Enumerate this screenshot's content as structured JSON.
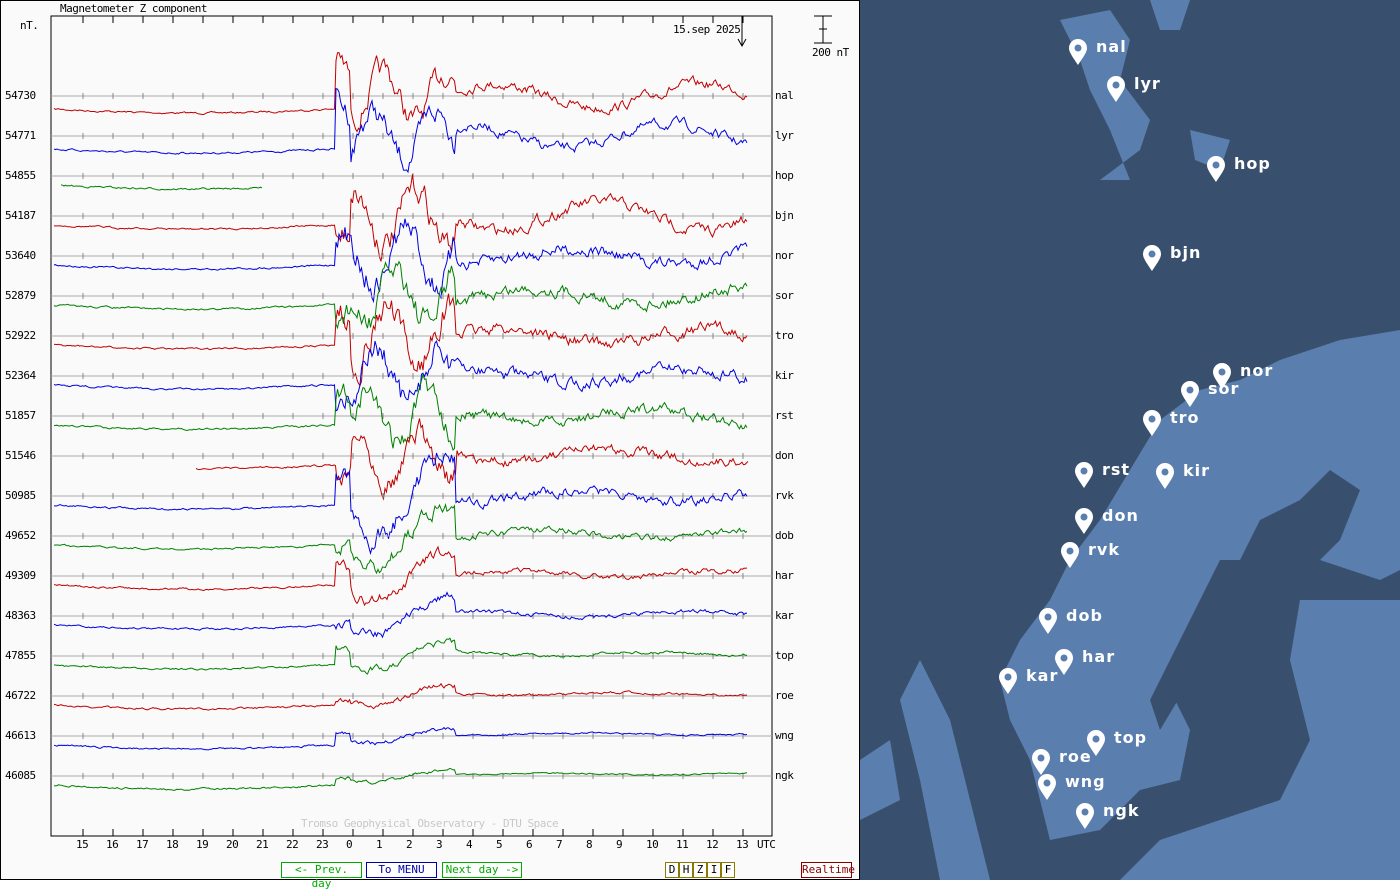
{
  "chart": {
    "title": "Magnetometer Z component",
    "unit": "nT.",
    "date": "15.sep 2025",
    "scale_label": "200 nT",
    "credit": "Tromso Geophysical Observatory - DTU Space",
    "x_ticks": [
      "15",
      "16",
      "17",
      "18",
      "19",
      "20",
      "21",
      "22",
      "23",
      "0",
      "1",
      "2",
      "3",
      "4",
      "5",
      "6",
      "7",
      "8",
      "9",
      "10",
      "11",
      "12",
      "13"
    ],
    "x_unit": "UTC"
  },
  "chart_data": {
    "type": "line",
    "title": "Magnetometer Z component",
    "xlabel": "UTC",
    "ylabel": "nT",
    "series": [
      {
        "name": "nal",
        "baseline": 54730,
        "color": "#c00000"
      },
      {
        "name": "lyr",
        "baseline": 54771,
        "color": "#0000e0"
      },
      {
        "name": "hop",
        "baseline": 54855,
        "color": "#008000"
      },
      {
        "name": "bjn",
        "baseline": 54187,
        "color": "#c00000"
      },
      {
        "name": "nor",
        "baseline": 53640,
        "color": "#0000e0"
      },
      {
        "name": "sor",
        "baseline": 52879,
        "color": "#008000"
      },
      {
        "name": "tro",
        "baseline": 52922,
        "color": "#c00000"
      },
      {
        "name": "kir",
        "baseline": 52364,
        "color": "#0000e0"
      },
      {
        "name": "rst",
        "baseline": 51857,
        "color": "#008000"
      },
      {
        "name": "don",
        "baseline": 51546,
        "color": "#c00000"
      },
      {
        "name": "rvk",
        "baseline": 50985,
        "color": "#0000e0"
      },
      {
        "name": "dob",
        "baseline": 49652,
        "color": "#008000"
      },
      {
        "name": "har",
        "baseline": 49309,
        "color": "#c00000"
      },
      {
        "name": "kar",
        "baseline": 48363,
        "color": "#0000e0"
      },
      {
        "name": "top",
        "baseline": 47855,
        "color": "#008000"
      },
      {
        "name": "roe",
        "baseline": 46722,
        "color": "#c00000"
      },
      {
        "name": "wng",
        "baseline": 46613,
        "color": "#0000e0"
      },
      {
        "name": "ngk",
        "baseline": 46085,
        "color": "#008000"
      }
    ]
  },
  "nav": {
    "prev": "<- Prev. day",
    "menu": "To MENU",
    "next": "Next day ->",
    "components": [
      "D",
      "H",
      "Z",
      "I",
      "F"
    ],
    "realtime": "Realtime"
  },
  "map": {
    "stations": [
      "nal",
      "lyr",
      "hop",
      "bjn",
      "nor",
      "sor",
      "tro",
      "rst",
      "kir",
      "don",
      "rvk",
      "dob",
      "har",
      "kar",
      "top",
      "roe",
      "wng",
      "ngk"
    ]
  },
  "colors": {
    "sea": "#38506e",
    "land": "#5a7fae"
  }
}
